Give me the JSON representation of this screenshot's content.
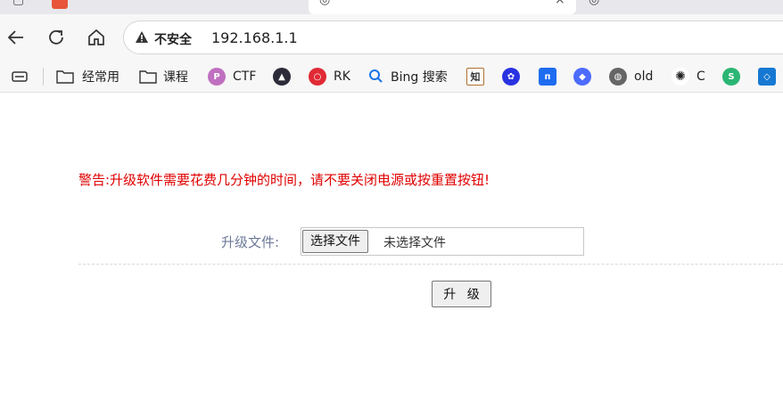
{
  "browser": {
    "omnibox": {
      "security_label": "不安全",
      "url": "192.168.1.1"
    },
    "bookmarks": [
      {
        "label": "",
        "icon": "reading-list-icon"
      },
      {
        "label": "经常用",
        "icon": "folder-icon"
      },
      {
        "label": "课程",
        "icon": "folder-icon"
      },
      {
        "label": "CTF",
        "icon": "ctf-site-icon"
      },
      {
        "label": "",
        "icon": "compass-site-icon"
      },
      {
        "label": "RK",
        "icon": "rk-site-icon"
      },
      {
        "label": "Bing 搜索",
        "icon": "search-icon"
      },
      {
        "label": "",
        "icon": "zhihu-icon"
      },
      {
        "label": "",
        "icon": "baidu-paw-icon"
      },
      {
        "label": "",
        "icon": "blue-app-icon"
      },
      {
        "label": "",
        "icon": "blue-bird-icon"
      },
      {
        "label": "old",
        "icon": "globe-icon"
      },
      {
        "label": "C",
        "icon": "openai-icon"
      },
      {
        "label": "",
        "icon": "green-app-icon"
      },
      {
        "label": "",
        "icon": "blue-cube-icon"
      }
    ]
  },
  "page": {
    "warning": "警告:升级软件需要花费几分钟的时间，请不要关闭电源或按重置按钮!",
    "file_label": "升级文件:",
    "choose_button": "选择文件",
    "no_file_text": "未选择文件",
    "upgrade_button": "升 级"
  },
  "colors": {
    "warning": "#e00000",
    "label": "#6d7a99"
  }
}
